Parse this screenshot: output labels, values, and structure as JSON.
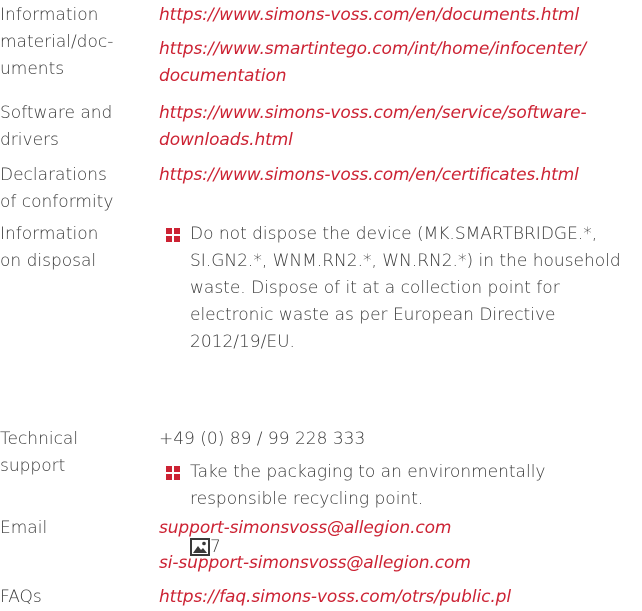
{
  "rows": [
    {
      "label_lines": [
        "Information",
        "material/doc-",
        "uments"
      ],
      "links": [
        "https://www.simons-voss.com/en/documents.html",
        "https://www.smartintego.com/int/home/infocenter/",
        "documentation"
      ]
    },
    {
      "label_lines": [
        "Software and",
        "drivers"
      ],
      "links": [
        "https://www.simons-voss.com/en/service/software-",
        "downloads.html"
      ]
    },
    {
      "label_lines": [
        "Declarations",
        "of conformity"
      ],
      "links": [
        "https://www.simons-voss.com/en/certificates.html"
      ]
    },
    {
      "label_lines": [
        "Information",
        "on disposal"
      ]
    },
    {
      "label_lines": [
        "Technical",
        "support"
      ],
      "value": "+49 (0) 89 / 99 228 333"
    },
    {
      "label_lines": [
        "Email"
      ],
      "links": [
        "support-simonsvoss@allegion.com",
        "si-support-simonsvoss@allegion.com"
      ]
    },
    {
      "label_lines": [
        "FAQs"
      ],
      "links": [
        "https://faq.simons-voss.com/otrs/public.pl"
      ]
    }
  ],
  "disposal_bullets": [
    {
      "lines": [
        "Do not dispose the device (MK.SMARTBRIDGE.*,",
        "SI.GN2.*, WNM.RN2.*, WN.RN2.*) in the household",
        "waste. Dispose of it at a collection point for",
        "electronic waste as per European Directive",
        "2012/19/EU."
      ]
    },
    {
      "lines": [
        "Take the packaging to an environmentally",
        "responsible recycling point."
      ]
    }
  ],
  "image_ref": "7",
  "icons": {
    "bullet": "red-square-bullet-icon",
    "image": "image-reference-icon"
  },
  "colors": {
    "link": "#cc2233",
    "text": "#3a3a3a",
    "bullet": "#cc2233"
  }
}
